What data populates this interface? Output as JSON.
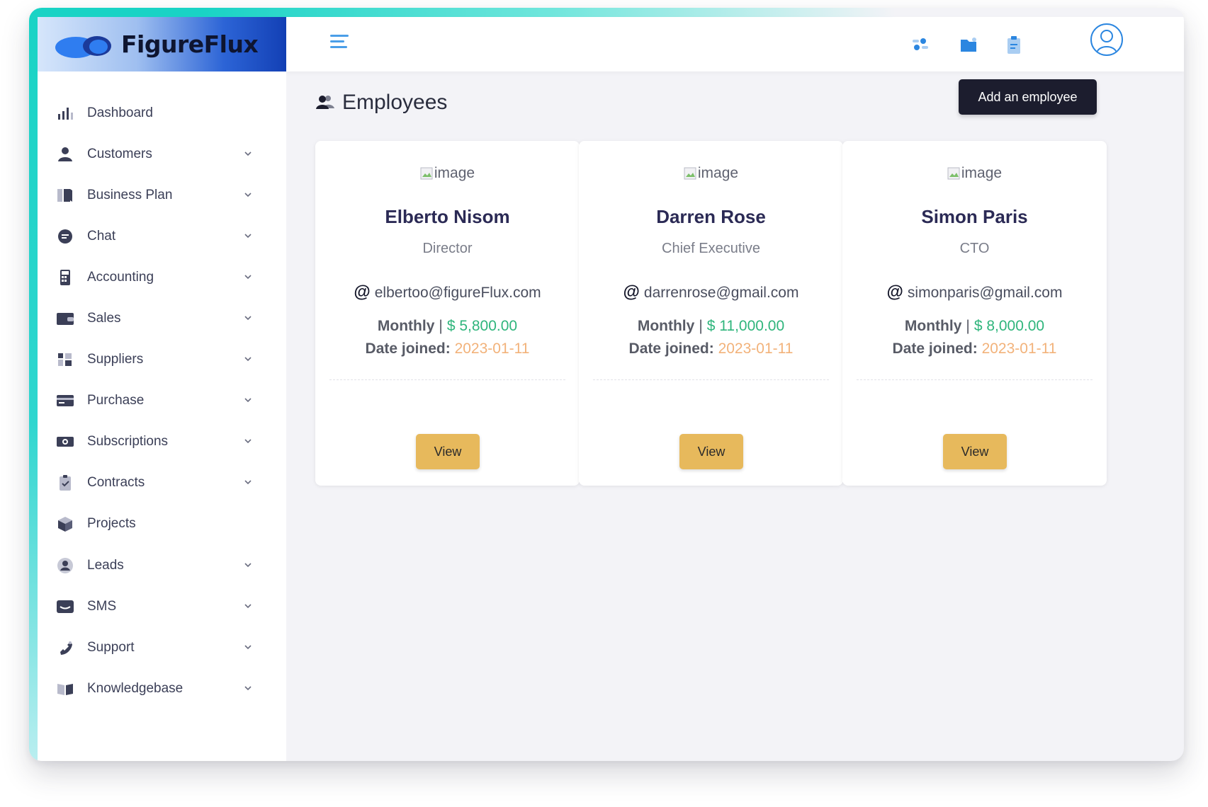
{
  "app": {
    "name": "FigureFlux"
  },
  "colors": {
    "accent_teal": "#19d3c5",
    "brand_blue": "#2b86e0",
    "salary_green": "#2fb57c",
    "date_orange": "#f2b27a",
    "view_button": "#e7b95c",
    "primary_button": "#1c1d2e"
  },
  "topbar": {
    "icons": [
      "menu-icon",
      "toggle-icon",
      "folder-icon",
      "clipboard-icon",
      "user-avatar-icon"
    ]
  },
  "sidebar": {
    "items": [
      {
        "label": "Dashboard",
        "icon": "bar-chart-icon",
        "expandable": false
      },
      {
        "label": "Customers",
        "icon": "person-icon",
        "expandable": true
      },
      {
        "label": "Business Plan",
        "icon": "book-icon",
        "expandable": true
      },
      {
        "label": "Chat",
        "icon": "chat-bubble-icon",
        "expandable": true
      },
      {
        "label": "Accounting",
        "icon": "calculator-icon",
        "expandable": true
      },
      {
        "label": "Sales",
        "icon": "wallet-icon",
        "expandable": true
      },
      {
        "label": "Suppliers",
        "icon": "grid-blocks-icon",
        "expandable": true
      },
      {
        "label": "Purchase",
        "icon": "credit-card-icon",
        "expandable": true
      },
      {
        "label": "Subscriptions",
        "icon": "money-icon",
        "expandable": true
      },
      {
        "label": "Contracts",
        "icon": "clipboard-check-icon",
        "expandable": true
      },
      {
        "label": "Projects",
        "icon": "cube-icon",
        "expandable": false
      },
      {
        "label": "Leads",
        "icon": "user-circle-icon",
        "expandable": true
      },
      {
        "label": "SMS",
        "icon": "message-icon",
        "expandable": true
      },
      {
        "label": "Support",
        "icon": "phone-icon",
        "expandable": true
      },
      {
        "label": "Knowledgebase",
        "icon": "open-book-icon",
        "expandable": true
      }
    ]
  },
  "main": {
    "title": "Employees",
    "add_button_label": "Add an employee",
    "employees": [
      {
        "image_alt": "image",
        "name": "Elberto Nisom",
        "role": "Director",
        "email": "elbertoo@figureFlux.com",
        "pay_label": "Monthly",
        "salary": "$ 5,800.00",
        "date_label": "Date joined:",
        "date_joined": "2023-01-11",
        "view_label": "View"
      },
      {
        "image_alt": "image",
        "name": "Darren Rose",
        "role": "Chief Executive",
        "email": "darrenrose@gmail.com",
        "pay_label": "Monthly",
        "salary": "$ 11,000.00",
        "date_label": "Date joined:",
        "date_joined": "2023-01-11",
        "view_label": "View"
      },
      {
        "image_alt": "image",
        "name": "Simon Paris",
        "role": "CTO",
        "email": "simonparis@gmail.com",
        "pay_label": "Monthly",
        "salary": "$ 8,000.00",
        "date_label": "Date joined:",
        "date_joined": "2023-01-11",
        "view_label": "View"
      }
    ]
  }
}
